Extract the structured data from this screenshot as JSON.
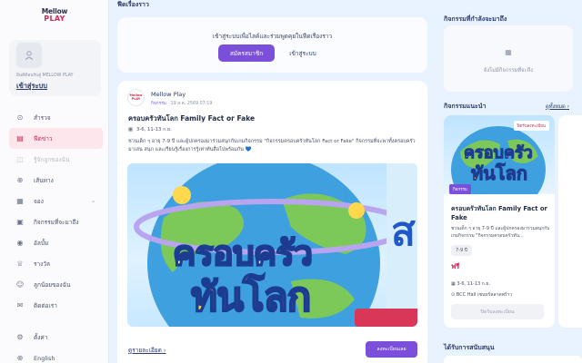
{
  "logo": {
    "line1": "Mellow",
    "line2": "PLAY"
  },
  "user": {
    "welcome": "ยินดีต้อนรับสู่ MELLOW PLAY",
    "login_link": "เข้าสู่ระบบ"
  },
  "nav": [
    {
      "icon": "compass-icon",
      "glyph": "⊙",
      "label": "สำรวจ",
      "state": "normal"
    },
    {
      "icon": "news-icon",
      "glyph": "▤",
      "label": "ฟีดข่าว",
      "state": "active"
    },
    {
      "icon": "shop-icon",
      "glyph": "◫",
      "label": "รู้จักลูกของฉัน",
      "state": "dim"
    },
    {
      "icon": "route-icon",
      "glyph": "⊕",
      "label": "เส้นทาง",
      "state": "normal"
    },
    {
      "icon": "calendar-icon",
      "glyph": "▦",
      "label": "จอง",
      "state": "normal",
      "chevron": true
    },
    {
      "icon": "calendar-check-icon",
      "glyph": "▣",
      "label": "กิจกรรมที่จะมาถึง",
      "state": "normal"
    },
    {
      "icon": "camera-icon",
      "glyph": "◉",
      "label": "อัลบั้ม",
      "state": "normal"
    },
    {
      "icon": "trophy-icon",
      "glyph": "♕",
      "label": "รางวัล",
      "state": "normal"
    },
    {
      "icon": "child-icon",
      "glyph": "☺",
      "label": "ลูกน้อยของฉัน",
      "state": "normal"
    },
    {
      "icon": "chat-icon",
      "glyph": "✉",
      "label": "ติดต่อเรา",
      "state": "normal"
    }
  ],
  "nav_bottom": [
    {
      "icon": "gear-icon",
      "glyph": "⚙",
      "label": "ตั้งค่า"
    },
    {
      "icon": "globe-icon",
      "glyph": "⊕",
      "label": "English"
    }
  ],
  "feed": {
    "title": "ฟีดเรื่องราว",
    "login_prompt": "เข้าสู่ระบบเพื่อไลค์และร่วมพูดคุยในฟีดเรื่องราว",
    "signup_label": "สมัครสมาชิก",
    "login_label": "เข้าสู่ระบบ"
  },
  "post": {
    "avatar_text": "Mellow PLAY",
    "author": "Mellow Play",
    "tag": "กิจกรรม",
    "timestamp": "· 19 ส.ค. 2569 07:19",
    "title": "ครอบครัวทันโลก Family Fact or Fake",
    "date": "3-6, 11-13 ก.ย.",
    "desc": "ชวนเด็ก ๆ อายุ 7-9 ปี และผู้ปกครองมาร่วมสนุกกับเกมกิจกรรม \"กิจกรรมครอบครัวทันโลก Fact or Fake\" กิจกรรมที่จะพาทั้งครอบครัวมาเล่น สนุก และเรียนรู้เรื่องการรู้เท่าทันสื่อไปพร้อมกัน 💙",
    "image_headline_1": "ครอบครัว",
    "image_headline_2": "ทันโลก",
    "image_side": "ส",
    "more_label": "ดูรายละเอียด",
    "register_label": "ลงทะเบียนเลย"
  },
  "right": {
    "upcoming_title": "กิจกรรมที่กำลังจะมาถึง",
    "upcoming_empty": "ยังไม่มีกิจกรรมที่จะถึง",
    "recommended_title": "กิจกรรมแนะนำ",
    "see_all": "ดูทั้งหมด",
    "support_title": "ได้รับการสนับสนุน"
  },
  "rec": {
    "ribbon": "ปิดรับลงทะเบียน",
    "badge": "กิจกรรม",
    "img_headline_1": "ครอบครัว",
    "img_headline_2": "ทันโลก",
    "title": "ครอบครัวทันโลก Family Fact or Fake",
    "desc": "ชวนเด็ก ๆ อายุ 7-9 ปี และผู้ปกครองมาร่วมสนุกกับเกมกิจกรรม \"กิจกรรมครอบครัวทัน...",
    "age": "7-9 ปี",
    "price": "ฟรี",
    "date": "3-6, 11-13 ก.ย.",
    "location": "BCC Hall เซนทรัลลาดพร้าว",
    "button": "ปิดรับลงทะเบียน"
  },
  "colors": {
    "accent": "#7b4fd9",
    "brand": "#c92a52",
    "navy": "#2b3a6b"
  }
}
